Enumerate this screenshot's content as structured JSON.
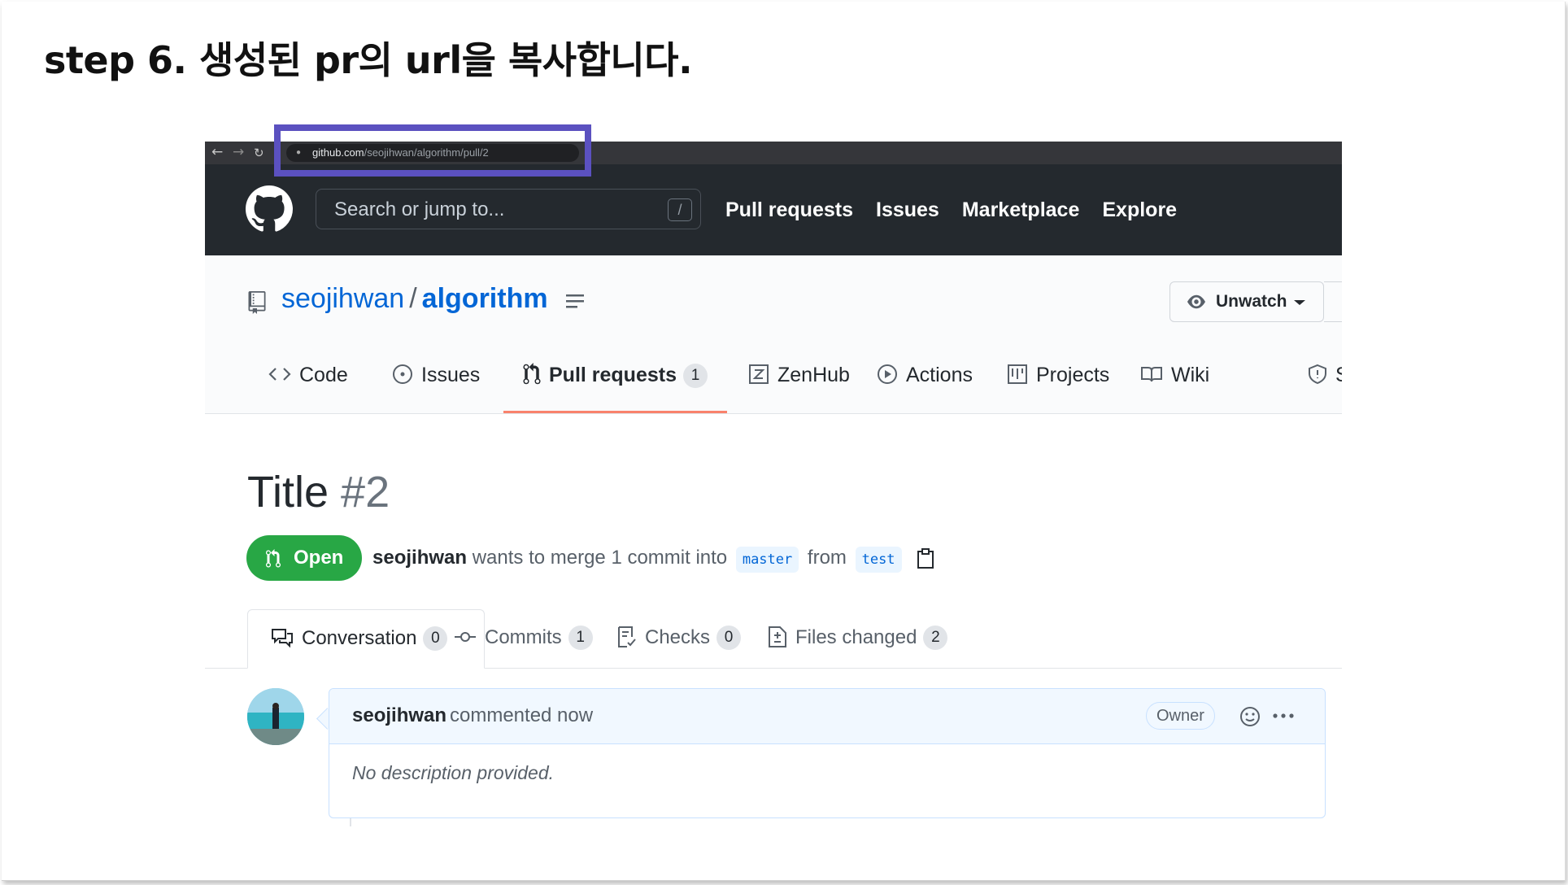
{
  "slide": {
    "heading": "step 6. 생성된 pr의 url을 복사합니다."
  },
  "browser": {
    "url_host": "github.com",
    "url_path": "/seojihwan/algorithm/pull/2",
    "icons": [
      "back-arrow-icon",
      "forward-arrow-icon",
      "reload-icon",
      "lock-icon"
    ]
  },
  "header": {
    "search_placeholder": "Search or jump to...",
    "search_shortcut": "/",
    "nav": [
      "Pull requests",
      "Issues",
      "Marketplace",
      "Explore"
    ]
  },
  "repo": {
    "owner": "seojihwan",
    "separator": "/",
    "name": "algorithm",
    "watch_label": "Unwatch"
  },
  "repo_tabs": [
    {
      "label": "Code",
      "icon": "code-icon"
    },
    {
      "label": "Issues",
      "icon": "issue-opened-icon"
    },
    {
      "label": "Pull requests",
      "icon": "git-pull-request-icon",
      "count": "1",
      "selected": true
    },
    {
      "label": "ZenHub",
      "icon": "zenhub-icon"
    },
    {
      "label": "Actions",
      "icon": "play-icon"
    },
    {
      "label": "Projects",
      "icon": "project-icon"
    },
    {
      "label": "Wiki",
      "icon": "book-icon"
    },
    {
      "label": "S",
      "icon": "shield-icon"
    }
  ],
  "pr": {
    "title": "Title",
    "number": "#2",
    "state": "Open",
    "author": "seojihwan",
    "merge_text": " wants to merge 1 commit into ",
    "base": "master",
    "from_text": " from ",
    "head": "test"
  },
  "pr_tabs": [
    {
      "label": "Conversation",
      "count": "0",
      "icon": "comment-discussion-icon",
      "selected": true
    },
    {
      "label": "Commits",
      "count": "1",
      "icon": "git-commit-icon"
    },
    {
      "label": "Checks",
      "count": "0",
      "icon": "checklist-icon"
    },
    {
      "label": "Files changed",
      "count": "2",
      "icon": "file-diff-icon"
    }
  ],
  "comment": {
    "author": "seojihwan",
    "action": "commented now",
    "role": "Owner",
    "body": "No description provided."
  },
  "colors": {
    "header_bg": "#24292e",
    "link": "#0366d6",
    "open_green": "#28a745",
    "tab_underline": "#f9826c",
    "highlight_box": "#5b51c0"
  }
}
